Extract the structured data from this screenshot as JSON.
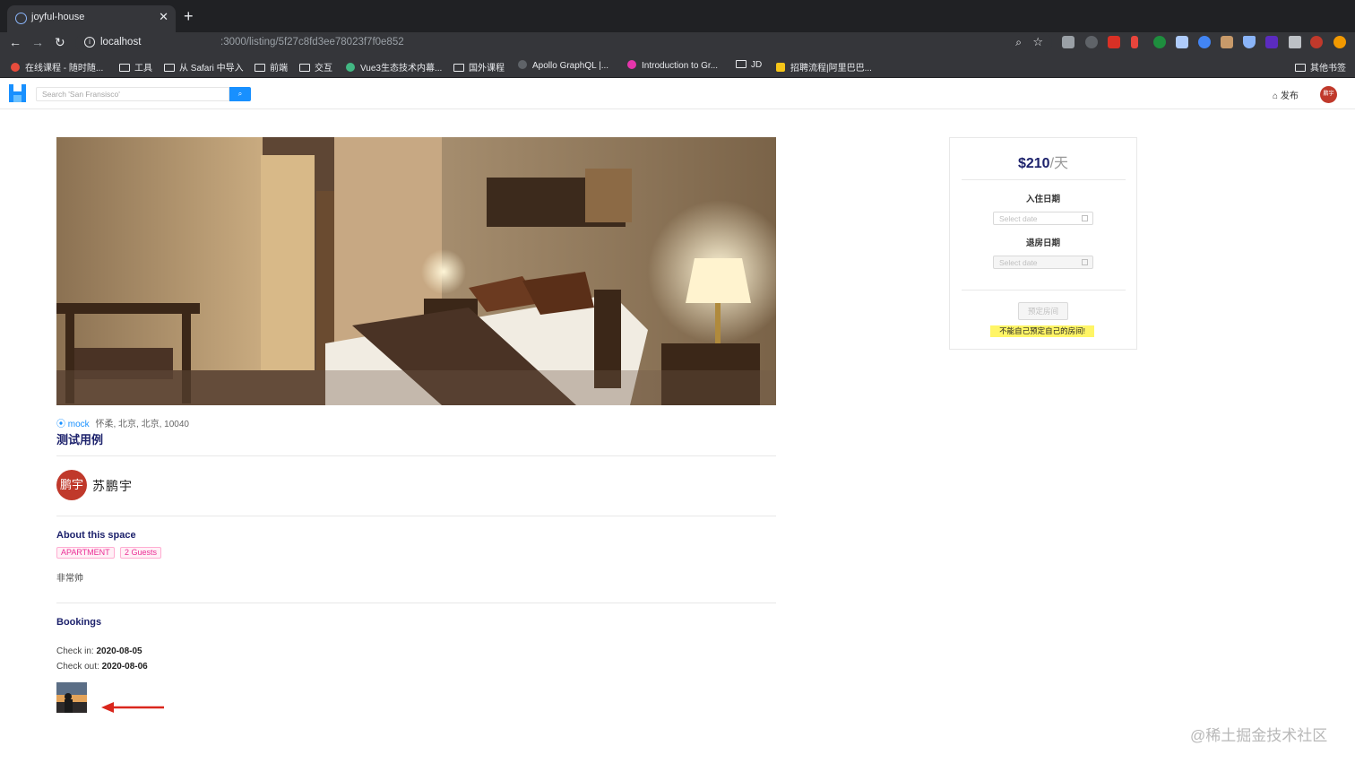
{
  "browser": {
    "tab_title": "joyful-house",
    "url_host": "localhost",
    "url_path": ":3000/listing/5f27c8fd3ee78023f7f0e852",
    "bookmarks": [
      {
        "label": "在线课程 - 随时随...",
        "icon": "logo"
      },
      {
        "label": "工具",
        "icon": "folder"
      },
      {
        "label": "从 Safari 中导入",
        "icon": "folder"
      },
      {
        "label": "前端",
        "icon": "folder"
      },
      {
        "label": "交互",
        "icon": "folder"
      },
      {
        "label": "Vue3生态技术内幕...",
        "icon": "vue"
      },
      {
        "label": "国外课程",
        "icon": "folder"
      },
      {
        "label": "Apollo GraphQL |...",
        "icon": "apollo"
      },
      {
        "label": "Introduction to Gr...",
        "icon": "graphql"
      },
      {
        "label": "JD",
        "icon": "folder"
      },
      {
        "label": "招聘流程|阿里巴巴...",
        "icon": "logo"
      },
      {
        "label": "其他书签",
        "icon": "folder"
      }
    ]
  },
  "header": {
    "search_placeholder": "Search 'San Fransisco'",
    "search_icon": "search-icon",
    "publish_label": "发布",
    "avatar_text": "鹏宇"
  },
  "listing": {
    "city": "mock",
    "address": "怀柔, 北京, 北京, 10040",
    "title": "测试用例",
    "host_avatar_text": "鹏宇",
    "host_name": "苏鹏宇",
    "about_heading": "About this space",
    "tags": [
      "APARTMENT",
      "2 Guests"
    ],
    "description": "非常帅",
    "bookings_heading": "Bookings",
    "checkin_label": "Check in: ",
    "checkin_value": "2020-08-05",
    "checkout_label": "Check out: ",
    "checkout_value": "2020-08-06"
  },
  "booking_card": {
    "price": "$210",
    "price_unit": "/天",
    "checkin_label": "入住日期",
    "checkin_placeholder": "Select date",
    "checkout_label": "退房日期",
    "checkout_placeholder": "Select date",
    "reserve_button": "预定房间",
    "warning": "不能自己预定自己的房间!"
  },
  "watermark": "@稀土掘金技术社区",
  "colors": {
    "accent": "#1890ff",
    "title": "#1d226c",
    "tag": "#eb2f96",
    "warning_bg": "#fff566",
    "avatar": "#c0392b",
    "arrow": "#d9261c"
  }
}
